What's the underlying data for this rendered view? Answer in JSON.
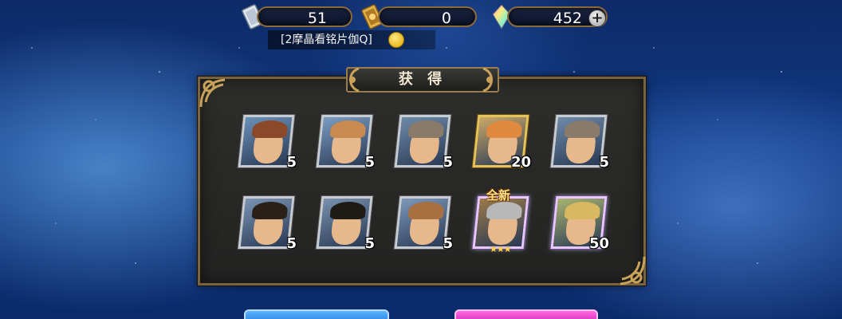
{
  "currencies": [
    {
      "name": "ticket",
      "value": "51",
      "icon": "silver-ticket-icon"
    },
    {
      "name": "gold-pass",
      "value": "0",
      "icon": "gold-pass-icon"
    },
    {
      "name": "gem",
      "value": "452",
      "icon": "rainbow-gem-icon"
    }
  ],
  "add_label": "+",
  "notice": "[2摩晶看铭片伽Q]",
  "panel": {
    "title": "获 得"
  },
  "items": [
    {
      "count": "5",
      "hair": "#8a4a2a",
      "bg": "#6a90b8",
      "frame": "silver"
    },
    {
      "count": "5",
      "hair": "#c88a50",
      "bg": "#7a9cc2",
      "frame": "silver"
    },
    {
      "count": "5",
      "hair": "#8a7a6a",
      "bg": "#6e8aa8",
      "frame": "silver"
    },
    {
      "count": "20",
      "hair": "#e08a40",
      "bg": "#caa868",
      "frame": "gold"
    },
    {
      "count": "5",
      "hair": "#8a7a6a",
      "bg": "#6e8aa8",
      "frame": "silver"
    },
    {
      "count": "5",
      "hair": "#2a2018",
      "bg": "#7a94b4",
      "frame": "silver"
    },
    {
      "count": "5",
      "hair": "#1e1a16",
      "bg": "#7890ae",
      "frame": "silver"
    },
    {
      "count": "5",
      "hair": "#a87040",
      "bg": "#7c98ba",
      "frame": "silver"
    },
    {
      "count": "",
      "hair": "#b8b8b8",
      "bg": "#9a7a4a",
      "frame": "rainbow"
    },
    {
      "count": "50",
      "hair": "#d8b860",
      "bg": "#a8b470",
      "frame": "rainbow"
    }
  ],
  "new_badge": "全新",
  "stars": "★★★",
  "colors": {
    "panel_border": "#7a6440",
    "gold_frame": "#e3c35a",
    "accent_text": "#ffe28a"
  }
}
